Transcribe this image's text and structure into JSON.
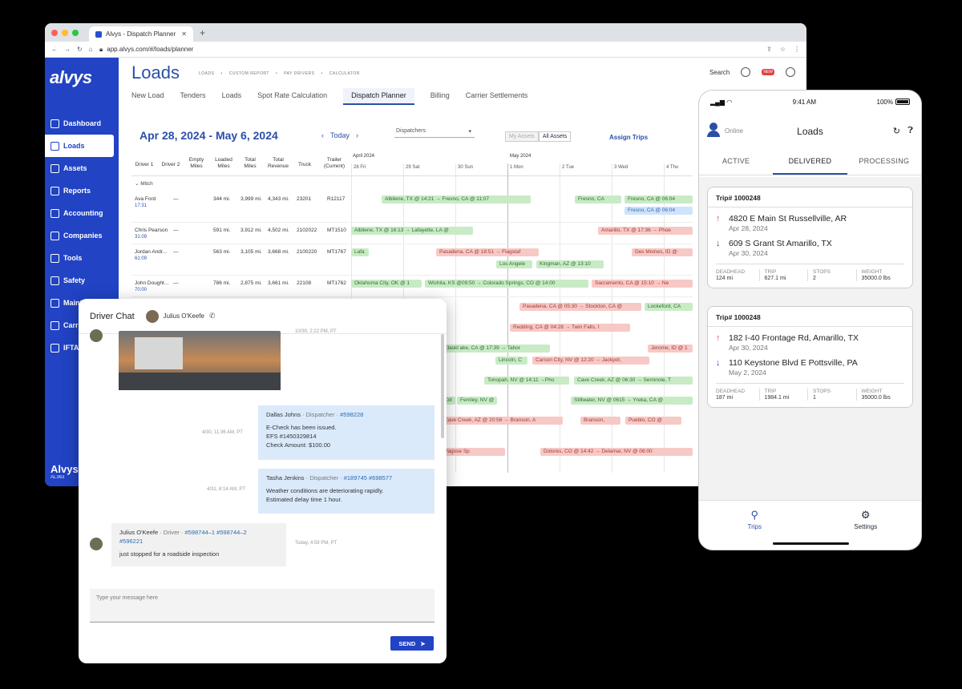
{
  "browser": {
    "tab_title": "Alvys - Dispatch Planner",
    "url": "app.alvys.com/#/loads/planner"
  },
  "sidebar": {
    "logo": "alvys",
    "items": [
      {
        "label": "Dashboard",
        "active": false
      },
      {
        "label": "Loads",
        "active": true
      },
      {
        "label": "Assets",
        "active": false
      },
      {
        "label": "Reports",
        "active": false
      },
      {
        "label": "Accounting",
        "active": false
      },
      {
        "label": "Companies",
        "active": false
      },
      {
        "label": "Tools",
        "active": false
      },
      {
        "label": "Safety",
        "active": false
      },
      {
        "label": "Maint",
        "active": false
      },
      {
        "label": "Carri",
        "active": false
      },
      {
        "label": "IFTA",
        "active": false
      }
    ],
    "footer_title": "Alvys",
    "footer_sub": "AL363"
  },
  "header": {
    "title": "Loads",
    "crumbs": [
      "LOADS",
      "CUSTOM REPORT",
      "PAY DRIVERS",
      "CALCULATOR"
    ],
    "search": "Search",
    "badge": "NEW"
  },
  "subnav": [
    "New Load",
    "Tenders",
    "Loads",
    "Spot Rate Calculation",
    "Dispatch Planner",
    "Billing",
    "Carrier Settlements"
  ],
  "planner": {
    "date_range": "Apr 28, 2024 - May 6, 2024",
    "today": "Today",
    "dispatchers": "Dispatchers",
    "my_assets": "My Assets",
    "all_assets": "All Assets",
    "assign_trips": "Assign Trips",
    "columns": [
      "Driver 1",
      "Driver 2",
      "Empty Miles",
      "Loaded Miles",
      "Total Miles",
      "Total Revenue",
      "Truck",
      "Trailer (Current)"
    ],
    "months": [
      "April 2024",
      "May 2024"
    ],
    "days": [
      "28 Fri",
      "29 Sat",
      "30 Sun",
      "1 Mon",
      "2 Tue",
      "3 Wed",
      "4 Thu"
    ],
    "group": "Mitch",
    "rows": [
      {
        "driver": "Ava Ford",
        "sub": "17:31",
        "d2": "—",
        "empty": "",
        "loaded": "344 mi.",
        "total": "3,999 mi.",
        "revenue": "4,343 mi.",
        "truck": "23201",
        "trailer": "R12117"
      },
      {
        "driver": "Chris Pearson",
        "sub": "31:09",
        "d2": "—",
        "empty": "",
        "loaded": "591 mi.",
        "total": "3,912 mi.",
        "revenue": "4,502 mi.",
        "truck": "2102022",
        "trailer": "MT1510"
      },
      {
        "driver": "Jordan Andr...",
        "sub": "61:09",
        "d2": "—",
        "empty": "",
        "loaded": "563 mi.",
        "total": "3,105 mi.",
        "revenue": "3,668 mi.",
        "truck": "2100220",
        "trailer": "MT1767"
      },
      {
        "driver": "John Dought...",
        "sub": "70:00",
        "d2": "—",
        "empty": "",
        "loaded": "786 mi.",
        "total": "2,875 mi.",
        "revenue": "3,661 mi.",
        "truck": "22108",
        "trailer": "MT1762"
      }
    ],
    "bars": [
      "Albilene, TX @ 14:21 → Fresno, CA @ 11:07",
      "Fresno, CA",
      "Fresno, CA @ 06:04",
      "Fresno, CA @ 06:04",
      "Albilene, TX @ 16:13 → Lafayette, LA @",
      "Amarillo, TX @ 17:36 → Phoe",
      "Lafa",
      "Pasadena, CA @ 18:51 → Flagstaf",
      "Des Moines, ID @",
      "Los Angele",
      "Kingman, AZ @ 13:10",
      "Oklahoma City, OK @ 1",
      "Wichita, KS @09:50 → Colorado Springs, CO @ 14:00",
      "Sacramento, CA @ 15:10 → Ne",
      "Pasadena, CA @ 05:30 → Stockton, CA @",
      "Lockeford, CA",
      "Redding, CA @ 04:28 → Twin Falls, I",
      "Claskl ake, CA @ 17:39 → Tahor",
      "Jerome, ID @ 1",
      "Lincoln, C",
      "Carson City, NV @ 12:20 → Jackpot,",
      "Tonopah, NV @ 14:11 →Pho",
      "Cave Creek, AZ @ 06:30 → Seminole, T",
      "Col",
      "Fernley, NV @",
      "Stillwater, NV @ 0615 → Yreka, CA @",
      "Cave Creek, AZ @ 20:56 → Branson, A",
      "Branson,",
      "Pueblo, CO @",
      "Pagose Sp",
      "Dolores, CO @ 14:42 → Delamar, NV @ 06:00"
    ]
  },
  "chat": {
    "title": "Driver Chat",
    "user": "Julius O'Keefe",
    "photo_ts": "10/30, 2:22 PM, PT",
    "messages": [
      {
        "name": "Dallas Johns",
        "role": " · Dispatcher · ",
        "tag": "#598228",
        "lines": [
          "E-Check has been issued.",
          "EFS #1450329814",
          "Check Amount: $100.00"
        ],
        "ts": "4/30, 11:36 AM, PT"
      },
      {
        "name": "Tasha Jenkins",
        "role": " · Dispatcher · ",
        "tag": "#189745 #698577",
        "lines": [
          "Weather conditions are deteriorating rapidly.",
          "Estimated delay time 1 hour."
        ],
        "ts": "4/31, 8:14 AM, PT"
      },
      {
        "name": "Julius O'Keefe",
        "role": " · Driver · ",
        "tag": "#598744–1 #598744–2",
        "tag2": "#596221",
        "lines": [
          "just stopped for a roadside inspection"
        ],
        "ts": "Today, 4:59 PM, PT"
      }
    ],
    "placeholder": "Type your message here",
    "send": "SEND"
  },
  "phone": {
    "time": "9:41 AM",
    "battery": "100%",
    "online": "Online",
    "title": "Loads",
    "tabs": [
      "ACTIVE",
      "DELIVERED",
      "PROCESSING"
    ],
    "cards": [
      {
        "trip": "Trip# 1000248",
        "from": "4820 E Main St Russellville, AR",
        "from_date": "Apr 28, 2024",
        "to": "609 S Grant St Amarillo, TX",
        "to_date": "Apr 30, 2024",
        "stats": [
          {
            "k": "DEADHEAD",
            "v": "124 mi"
          },
          {
            "k": "TRIP",
            "v": "627.1 mi"
          },
          {
            "k": "STOPS",
            "v": "2"
          },
          {
            "k": "WEIGHT",
            "v": "35000.0 lbs"
          }
        ]
      },
      {
        "trip": "Trip# 1000248",
        "from": "182 I-40 Frontage Rd, Amarillo, TX",
        "from_date": "Apr 30, 2024",
        "to": "110 Keystone Blvd E Pottsville, PA",
        "to_date": "May 2, 2024",
        "stats": [
          {
            "k": "DEADHEAD",
            "v": "187 mi"
          },
          {
            "k": "TRIP",
            "v": "1984.1 mi"
          },
          {
            "k": "STOPS",
            "v": "1"
          },
          {
            "k": "WEIGHT",
            "v": "35000.0 lbs"
          }
        ]
      }
    ],
    "footer": [
      "Trips",
      "Settings"
    ]
  }
}
